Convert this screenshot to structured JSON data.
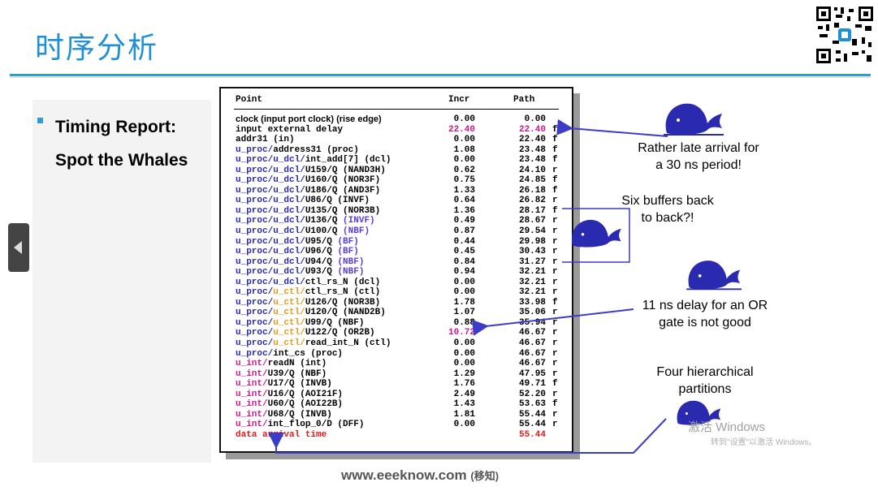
{
  "slide": {
    "title": "时序分析",
    "bullet": "Timing Report: Spot the Whales",
    "bullet_line1": "Timing Report:",
    "bullet_line2": "Spot the Whales",
    "footer_site": "www.eeeknow.com",
    "footer_cn": "(移知)"
  },
  "report": {
    "headers": {
      "point": "Point",
      "incr": "Incr",
      "path": "Path"
    },
    "rows": [
      {
        "p": "clock (input port clock) (rise edge)",
        "i": "0.00",
        "t": "0.00",
        "f": ""
      },
      {
        "p": "input external delay",
        "i": "22.40",
        "t": "22.40",
        "f": "f"
      },
      {
        "p": "addr31 (in)",
        "i": "0.00",
        "t": "22.40",
        "f": "f"
      },
      {
        "p": "u_proc/address31 (proc)",
        "i": "1.08",
        "t": "23.48",
        "f": "f"
      },
      {
        "p": "u_proc/u_dcl/int_add[7] (dcl)",
        "i": "0.00",
        "t": "23.48",
        "f": "f"
      },
      {
        "p": "u_proc/u_dcl/U159/Q (NAND3H)",
        "i": "0.62",
        "t": "24.10",
        "f": "r"
      },
      {
        "p": "u_proc/u_dcl/U160/Q (NOR3F)",
        "i": "0.75",
        "t": "24.85",
        "f": "f"
      },
      {
        "p": "u_proc/u_dcl/U186/Q (AND3F)",
        "i": "1.33",
        "t": "26.18",
        "f": "f"
      },
      {
        "p": "u_proc/u_dcl/U86/Q (INVF)",
        "i": "0.64",
        "t": "26.82",
        "f": "r"
      },
      {
        "p": "u_proc/u_dcl/U135/Q (NOR3B)",
        "i": "1.36",
        "t": "28.17",
        "f": "f"
      },
      {
        "p": "u_proc/u_dcl/U136/Q (INVF)",
        "i": "0.49",
        "t": "28.67",
        "f": "r"
      },
      {
        "p": "u_proc/u_dcl/U100/Q (NBF)",
        "i": "0.87",
        "t": "29.54",
        "f": "r"
      },
      {
        "p": "u_proc/u_dcl/U95/Q (BF)",
        "i": "0.44",
        "t": "29.98",
        "f": "r"
      },
      {
        "p": "u_proc/u_dcl/U96/Q (BF)",
        "i": "0.45",
        "t": "30.43",
        "f": "r"
      },
      {
        "p": "u_proc/u_dcl/U94/Q (NBF)",
        "i": "0.84",
        "t": "31.27",
        "f": "r"
      },
      {
        "p": "u_proc/u_dcl/U93/Q (NBF)",
        "i": "0.94",
        "t": "32.21",
        "f": "r"
      },
      {
        "p": "u_proc/u_dcl/ctl_rs_N (dcl)",
        "i": "0.00",
        "t": "32.21",
        "f": "r"
      },
      {
        "p": "u_proc/u_ctl/ctl_rs_N (ctl)",
        "i": "0.00",
        "t": "32.21",
        "f": "r"
      },
      {
        "p": "u_proc/u_ctl/U126/Q (NOR3B)",
        "i": "1.78",
        "t": "33.98",
        "f": "f"
      },
      {
        "p": "u_proc/u_ctl/U120/Q (NAND2B)",
        "i": "1.07",
        "t": "35.06",
        "f": "r"
      },
      {
        "p": "u_proc/u_ctl/U99/Q (NBF)",
        "i": "0.88",
        "t": "35.94",
        "f": "r"
      },
      {
        "p": "u_proc/u_ctl/U122/Q (OR2B)",
        "i": "10.72",
        "t": "46.67",
        "f": "r"
      },
      {
        "p": "u_proc/u_ctl/read_int_N (ctl)",
        "i": "0.00",
        "t": "46.67",
        "f": "r"
      },
      {
        "p": "u_proc/int_cs (proc)",
        "i": "0.00",
        "t": "46.67",
        "f": "r"
      },
      {
        "p": "u_int/readN (int)",
        "i": "0.00",
        "t": "46.67",
        "f": "r"
      },
      {
        "p": "u_int/U39/Q (NBF)",
        "i": "1.29",
        "t": "47.95",
        "f": "r"
      },
      {
        "p": "u_int/U17/Q (INVB)",
        "i": "1.76",
        "t": "49.71",
        "f": "f"
      },
      {
        "p": "u_int/U16/Q (AOI21F)",
        "i": "2.49",
        "t": "52.20",
        "f": "r"
      },
      {
        "p": "u_int/U60/Q (AOI22B)",
        "i": "1.43",
        "t": "53.63",
        "f": "f"
      },
      {
        "p": "u_int/U68/Q (INVB)",
        "i": "1.81",
        "t": "55.44",
        "f": "r"
      },
      {
        "p": "u_int/int_flop_0/D (DFF)",
        "i": "0.00",
        "t": "55.44",
        "f": "r"
      },
      {
        "p": "data arrival time",
        "i": "",
        "t": "55.44",
        "f": ""
      }
    ]
  },
  "notes": {
    "late_arrival_1": "Rather late arrival for",
    "late_arrival_2": "a 30 ns period!",
    "buffers_1": "Six buffers back",
    "buffers_2": "to back?!",
    "or_gate_1": "11 ns delay for an OR",
    "or_gate_2": "gate is not good",
    "partitions_1": "Four hierarchical",
    "partitions_2": "partitions"
  },
  "watermark": {
    "windows_1": "激活 Windows",
    "windows_2": "转到\"设置\"以激活 Windows。"
  },
  "colors": {
    "title": "#1f8fd6",
    "accent": "#2c9bd6",
    "whale": "#2a2ab0",
    "arrow": "#3c3cc8",
    "incr_red": "#cc1a8a",
    "hier_orange": "#e59a1a"
  },
  "icons": [
    "whale-icon",
    "qr-code-icon",
    "prev-slide-arrow-icon"
  ]
}
